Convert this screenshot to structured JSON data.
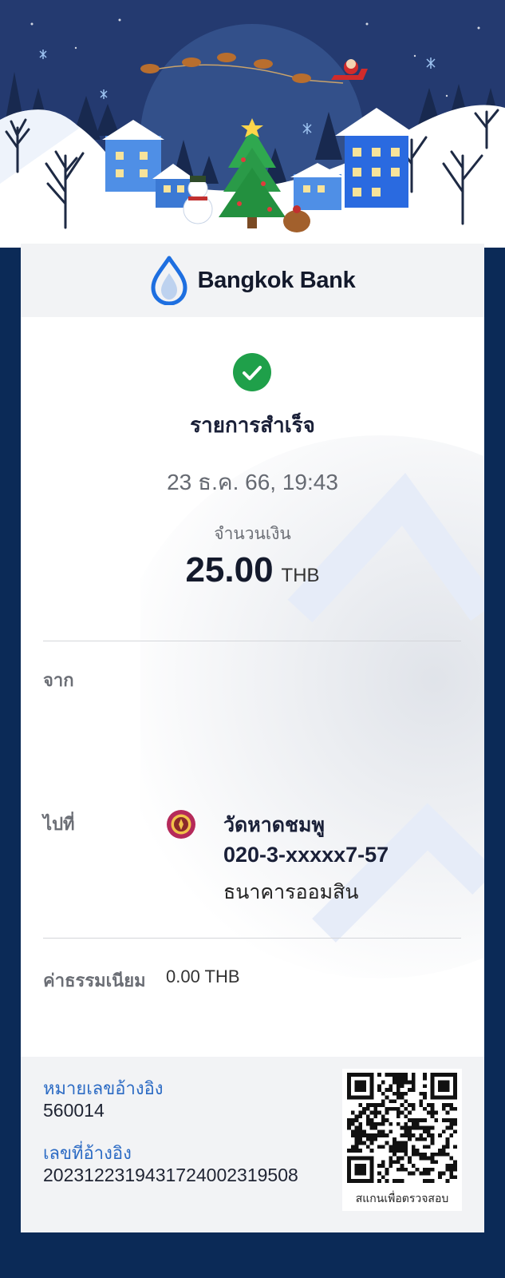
{
  "header": {
    "bank_name": "Bangkok Bank"
  },
  "status": {
    "title": "รายการสำเร็จ"
  },
  "transaction": {
    "datetime": "23 ธ.ค. 66, 19:43",
    "amount_label": "จำนวนเงิน",
    "amount": "25.00",
    "currency": "THB"
  },
  "from": {
    "label": "จาก"
  },
  "to": {
    "label": "ไปที่",
    "name": "วัดหาดชมพู",
    "account": "020-3-xxxxx7-57",
    "bank": "ธนาคารออมสิน"
  },
  "fee": {
    "label": "ค่าธรรมเนียม",
    "value": "0.00 THB"
  },
  "reference": {
    "ref1_label": "หมายเลขอ้างอิง",
    "ref1_value": "560014",
    "ref2_label": "เลขที่อ้างอิง",
    "ref2_value": "2023122319431724002319508"
  },
  "qr": {
    "caption": "สแกนเพื่อตรวจสอบ"
  },
  "colors": {
    "background": "#0b2a57",
    "brand": "#1e6fe0",
    "success": "#1fa04a",
    "reference_label": "#2c6bc4"
  }
}
